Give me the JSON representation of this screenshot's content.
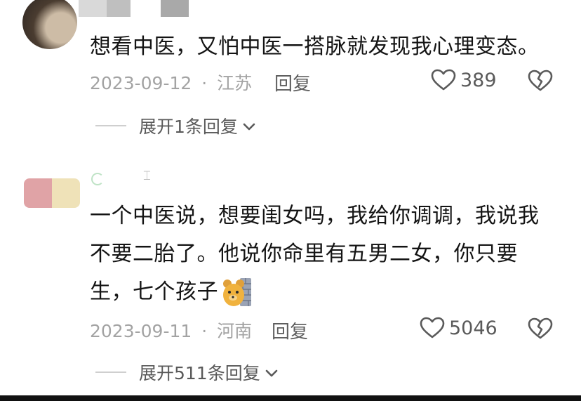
{
  "comments": [
    {
      "text_lines": [
        "想看中医，又怕中医一搭脉就发现我心理变态。"
      ],
      "date": "2023-09-12",
      "separator": "·",
      "location": "江苏",
      "reply_label": "回复",
      "likes": "389",
      "expand_label": "展开1条回复"
    },
    {
      "text_lines": [
        "一个中医说，想要闺女吗，我给你调调，我说我",
        "不要二胎了。他说你命里有五男二女，你只要",
        "生，七个孩子"
      ],
      "emoji_icon": "bear-peeking-from-wall-emoji",
      "date": "2023-09-11",
      "separator": "·",
      "location": "河南",
      "reply_label": "回复",
      "likes": "5046",
      "expand_label": "展开511条回复"
    }
  ],
  "colors": {
    "text": "#141414",
    "meta": "#a3a3a3",
    "action": "#5a5a5a"
  },
  "icons": {
    "like": "heart-outline-icon",
    "dislike": "broken-heart-icon",
    "expand": "chevron-down-icon"
  }
}
